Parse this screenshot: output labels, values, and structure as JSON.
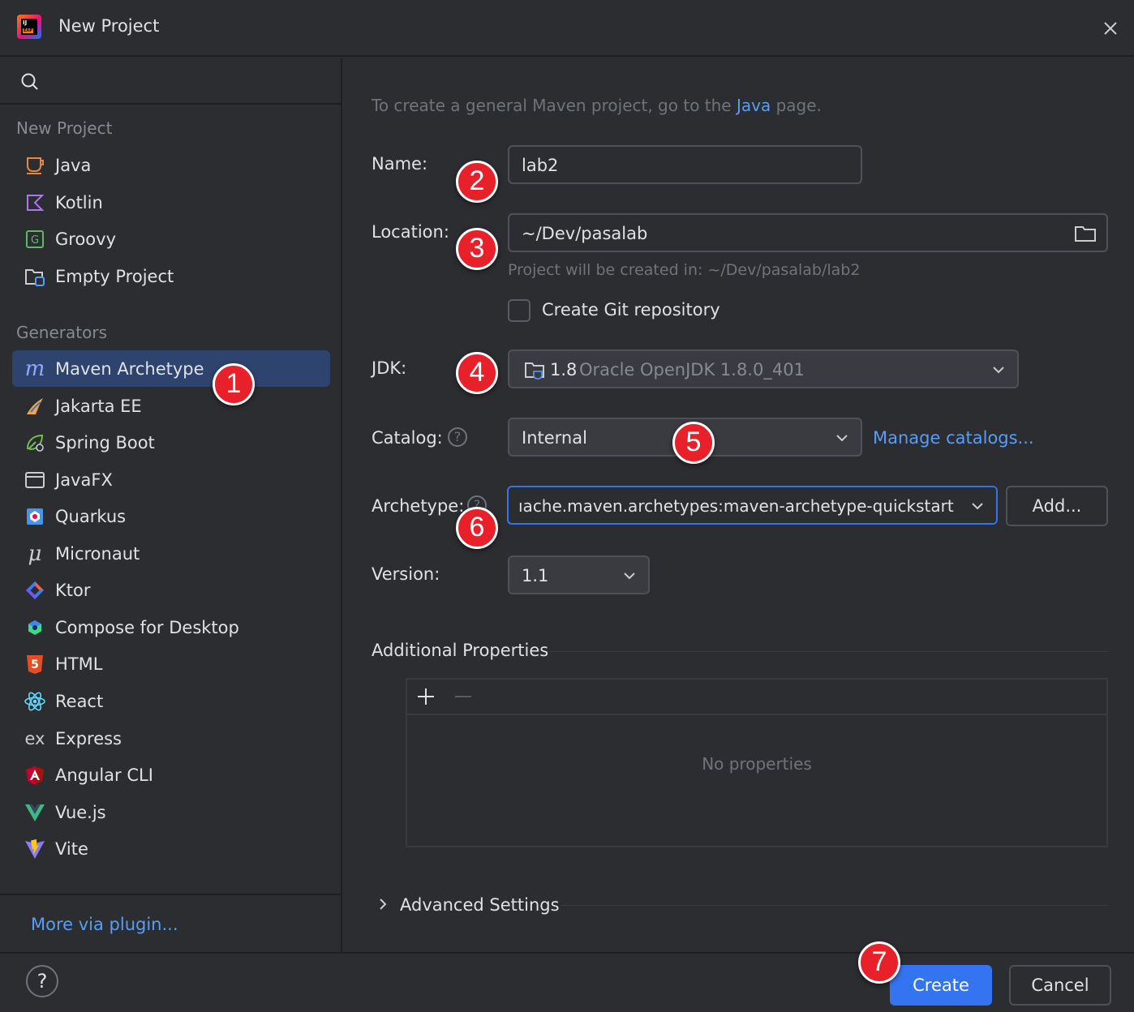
{
  "window": {
    "title": "New Project",
    "app_logo_text": "IJ",
    "app_logo_badge": "EAP",
    "close_icon": "close-icon"
  },
  "sidebar": {
    "search_icon": "search-icon",
    "sections": [
      {
        "header": "New Project",
        "items": [
          {
            "label": "Java",
            "icon": "java-icon"
          },
          {
            "label": "Kotlin",
            "icon": "kotlin-icon"
          },
          {
            "label": "Groovy",
            "icon": "groovy-icon"
          },
          {
            "label": "Empty Project",
            "icon": "empty-project-icon"
          }
        ]
      },
      {
        "header": "Generators",
        "items": [
          {
            "label": "Maven Archetype",
            "icon": "maven-icon",
            "selected": true
          },
          {
            "label": "Jakarta EE",
            "icon": "jakarta-icon"
          },
          {
            "label": "Spring Boot",
            "icon": "spring-icon"
          },
          {
            "label": "JavaFX",
            "icon": "javafx-icon"
          },
          {
            "label": "Quarkus",
            "icon": "quarkus-icon"
          },
          {
            "label": "Micronaut",
            "icon": "micronaut-icon"
          },
          {
            "label": "Ktor",
            "icon": "ktor-icon"
          },
          {
            "label": "Compose for Desktop",
            "icon": "compose-icon"
          },
          {
            "label": "HTML",
            "icon": "html-icon"
          },
          {
            "label": "React",
            "icon": "react-icon"
          },
          {
            "label": "Express",
            "icon": "express-icon"
          },
          {
            "label": "Angular CLI",
            "icon": "angular-icon"
          },
          {
            "label": "Vue.js",
            "icon": "vue-icon"
          },
          {
            "label": "Vite",
            "icon": "vite-icon"
          }
        ]
      }
    ],
    "more_link": "More via plugin..."
  },
  "main": {
    "hint_prefix": "To create a general Maven project, go to the ",
    "hint_link": "Java",
    "hint_suffix": " page.",
    "name": {
      "label": "Name:",
      "value": "lab2"
    },
    "location": {
      "label": "Location:",
      "value": "~/Dev/pasalab",
      "folder_icon": "folder-icon",
      "created_in": "Project will be created in: ~/Dev/pasalab/lab2"
    },
    "git": {
      "label": "Create Git repository",
      "checked": false
    },
    "jdk": {
      "label": "JDK:",
      "version": "1.8",
      "name": "Oracle OpenJDK 1.8.0_401",
      "icon": "jdk-folder-icon"
    },
    "catalog": {
      "label": "Catalog:",
      "value": "Internal",
      "manage_link": "Manage catalogs..."
    },
    "archetype": {
      "label": "Archetype:",
      "value": "ıache.maven.archetypes:maven-archetype-quickstart",
      "add_button": "Add..."
    },
    "version": {
      "label": "Version:",
      "value": "1.1"
    },
    "additional_properties": {
      "title": "Additional Properties",
      "empty_text": "No properties",
      "add_icon": "plus-icon",
      "remove_icon": "minus-icon"
    },
    "advanced_settings": {
      "title": "Advanced Settings",
      "icon": "chevron-right-icon"
    }
  },
  "footer": {
    "help": "?",
    "create": "Create",
    "cancel": "Cancel"
  },
  "annotations": [
    "1",
    "2",
    "3",
    "4",
    "5",
    "6",
    "7"
  ],
  "colors": {
    "background": "#2b2d30",
    "accent": "#3574f0",
    "link": "#589df6",
    "selection": "#2e436e",
    "badge": "#e8202a"
  }
}
